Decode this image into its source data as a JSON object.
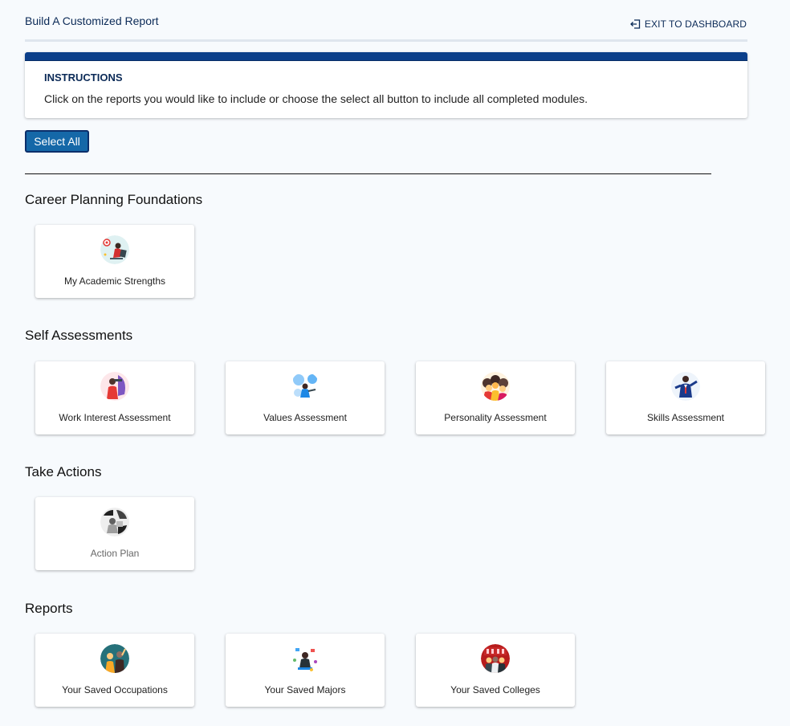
{
  "header": {
    "title": "Build A Customized Report",
    "exit_label": "EXIT TO DASHBOARD",
    "exit_icon": "exit-arrow-icon"
  },
  "instructions": {
    "heading": "INSTRUCTIONS",
    "text": "Click on the reports you would like to include or choose the select all button to include all completed modules."
  },
  "select_all_label": "Select All",
  "sections": [
    {
      "title": "Career Planning Foundations",
      "cards": [
        {
          "label": "My Academic Strengths",
          "icon": "academic-strengths-icon"
        }
      ]
    },
    {
      "title": "Self Assessments",
      "cards": [
        {
          "label": "Work Interest Assessment",
          "icon": "work-interest-icon"
        },
        {
          "label": "Values Assessment",
          "icon": "values-icon"
        },
        {
          "label": "Personality Assessment",
          "icon": "personality-icon"
        },
        {
          "label": "Skills Assessment",
          "icon": "skills-icon"
        }
      ]
    },
    {
      "title": "Take Actions",
      "cards": [
        {
          "label": "Action Plan",
          "icon": "action-plan-icon"
        }
      ]
    },
    {
      "title": "Reports",
      "cards": [
        {
          "label": "Your Saved Occupations",
          "icon": "saved-occupations-icon"
        },
        {
          "label": "Your Saved Majors",
          "icon": "saved-majors-icon"
        },
        {
          "label": "Your Saved Colleges",
          "icon": "saved-colleges-icon"
        }
      ]
    }
  ],
  "colors": {
    "brand_navy": "#0b2a57",
    "instructions_bar": "#0b3f8a",
    "button_blue": "#1568a8",
    "page_bg": "#f7fafd"
  }
}
